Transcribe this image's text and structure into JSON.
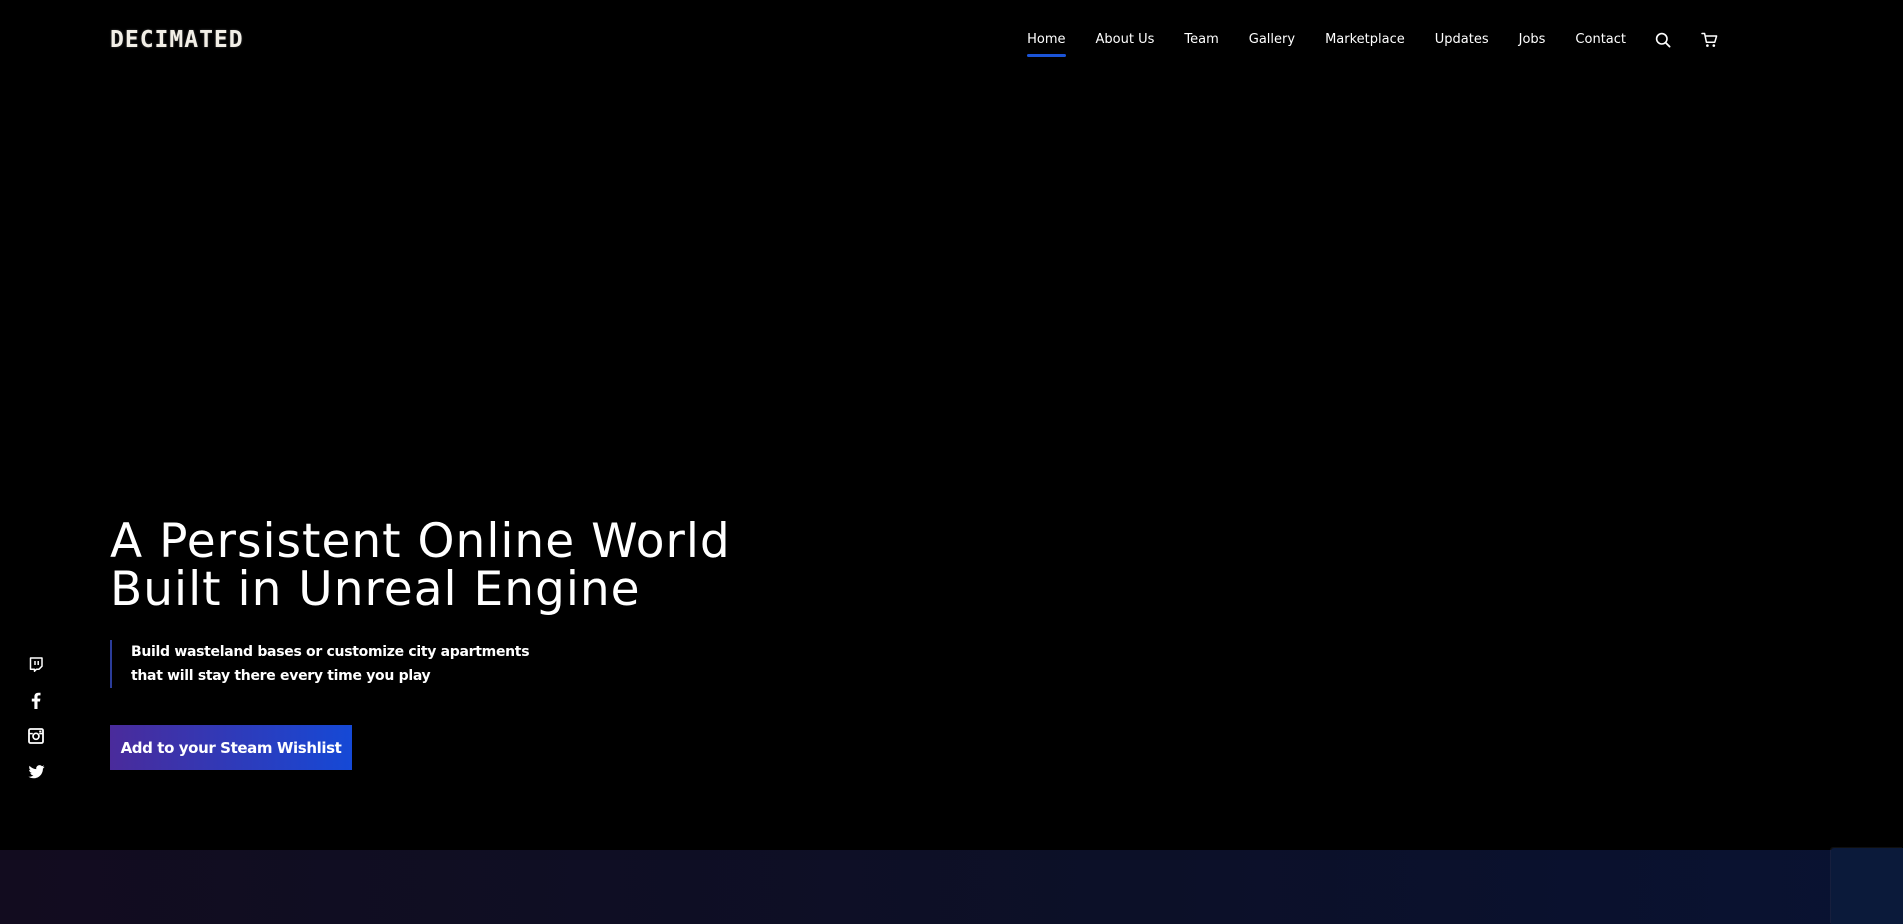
{
  "brand": {
    "logo_text": "DECIMATED"
  },
  "nav": {
    "items": [
      {
        "label": "Home",
        "active": true
      },
      {
        "label": "About Us",
        "active": false
      },
      {
        "label": "Team",
        "active": false
      },
      {
        "label": "Gallery",
        "active": false
      },
      {
        "label": "Marketplace",
        "active": false
      },
      {
        "label": "Updates",
        "active": false
      },
      {
        "label": "Jobs",
        "active": false
      },
      {
        "label": "Contact",
        "active": false
      }
    ],
    "icons": [
      "search-icon",
      "cart-icon"
    ]
  },
  "hero": {
    "title_line1": "A Persistent Online World",
    "title_line2": "Built in Unreal Engine",
    "subtitle_line1": "Build wasteland bases or customize city apartments",
    "subtitle_line2": "that will stay there every time you play",
    "cta_label": "Add to your Steam Wishlist"
  },
  "social": {
    "icons": [
      "twitch-icon",
      "facebook-icon",
      "instagram-icon",
      "twitter-icon"
    ]
  },
  "colors": {
    "background": "#000000",
    "accent_blue": "#1b54d8",
    "cta_gradient_start": "#4a2b9b",
    "cta_gradient_end": "#1549d6",
    "bottom_band": "#0c1028"
  }
}
